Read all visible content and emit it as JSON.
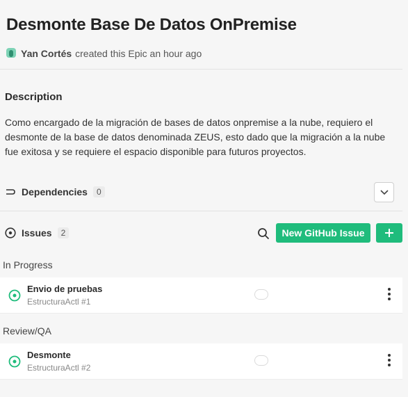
{
  "epic": {
    "title": "Desmonte Base De Datos OnPremise",
    "author": "Yan Cortés",
    "created_text": "created this Epic an hour ago"
  },
  "description": {
    "heading": "Description",
    "body": "Como encargado de la migración de bases de datos onpremise a la nube, requiero el desmonte de la base de datos denominada ZEUS, esto dado que la migración a la nube fue exitosa y se requiere el espacio disponible para futuros proyectos."
  },
  "dependencies": {
    "label": "Dependencies",
    "count": "0"
  },
  "issues": {
    "label": "Issues",
    "count": "2",
    "new_button_label": "New GitHub Issue",
    "groups": [
      {
        "label": "In Progress",
        "items": [
          {
            "name": "Envio de pruebas",
            "ref": "EstructuraActl #1"
          }
        ]
      },
      {
        "label": "Review/QA",
        "items": [
          {
            "name": "Desmonte",
            "ref": "EstructuraActl #2"
          }
        ]
      }
    ]
  },
  "colors": {
    "accent": "#1fbc7c",
    "background": "#f6f6f6"
  },
  "icons": {
    "avatar": "user-avatar-icon",
    "dependencies": "dependencies-icon",
    "collapse": "chevron-down-icon",
    "issues": "issue-circle-icon",
    "search": "search-icon",
    "add": "plus-icon",
    "status": "open-issue-icon",
    "menu": "more-vertical-icon"
  }
}
